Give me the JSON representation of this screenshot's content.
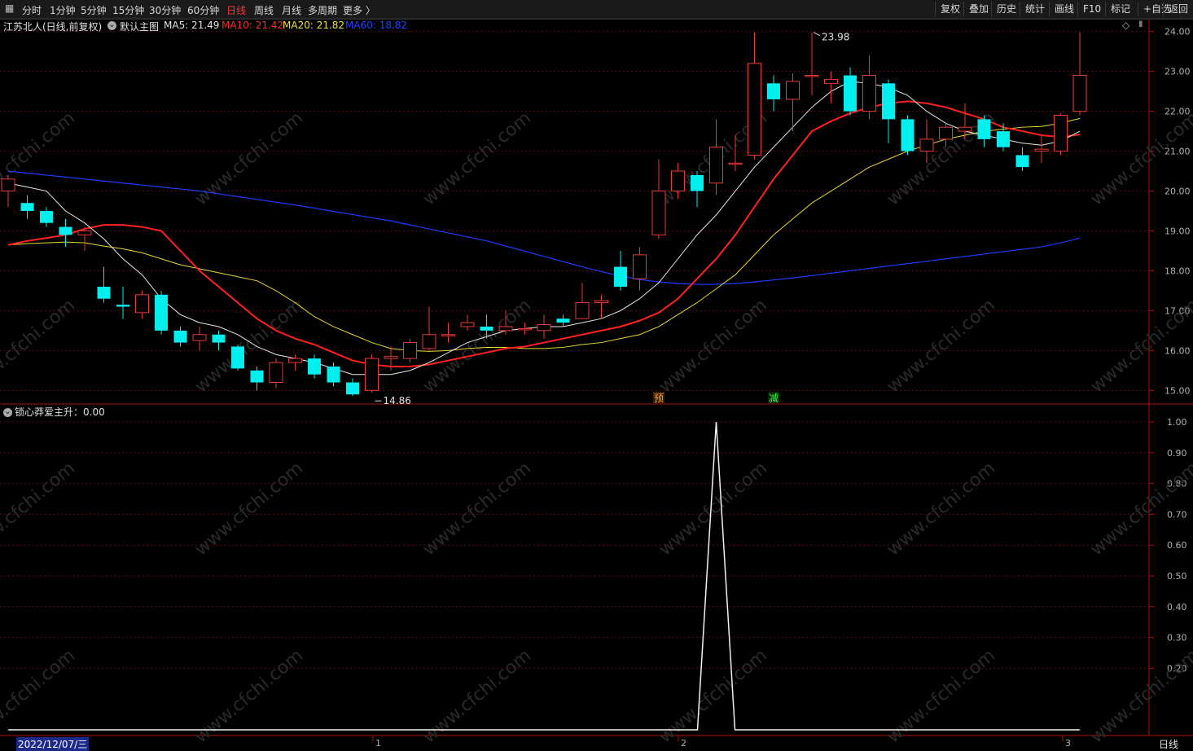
{
  "toolbar": {
    "left_icon": "grid-icon",
    "periods": [
      "分时",
      "1分钟",
      "5分钟",
      "15分钟",
      "30分钟",
      "60分钟",
      "日线",
      "周线",
      "月线",
      "多周期",
      "更多 〉"
    ],
    "active_period": "日线",
    "right": [
      "复权",
      "叠加",
      "历史",
      "统计",
      "画线",
      "F10",
      "标记",
      "+自选",
      "返回"
    ]
  },
  "main_panel": {
    "stock_title": "江苏北人(日线,前复权)",
    "template": "默认主图",
    "ma": [
      {
        "label": "MA5: 21.49",
        "color": "#e0e0e0"
      },
      {
        "label": "MA10: 21.42",
        "color": "#ff2a2a"
      },
      {
        "label": "MA20: 21.82",
        "color": "#f0e030"
      },
      {
        "label": "MA60: 18.82",
        "color": "#2040ff"
      }
    ],
    "high_label": "23.98",
    "low_label": "14.86",
    "signal_yu": "预",
    "signal_jian": "减",
    "y_ticks": [
      "24.00",
      "23.00",
      "22.00",
      "21.00",
      "20.00",
      "19.00",
      "18.00",
      "17.00",
      "16.00",
      "15.00"
    ]
  },
  "sub_panel": {
    "indicator": "锁心莽爱主升：0.00",
    "y_ticks": [
      "1.00",
      "0.90",
      "0.80",
      "0.70",
      "0.60",
      "0.50",
      "0.40",
      "0.30",
      "0.20"
    ]
  },
  "x_axis": {
    "cursor_date": "2022/12/07/三",
    "months": [
      "1",
      "2",
      "3"
    ],
    "period_button": "日线"
  },
  "watermark": "www.cfchi.com",
  "chart_data": {
    "type": "candlestick",
    "ylim": [
      14.6,
      24.4
    ],
    "candles": [
      {
        "o": 20.0,
        "c": 20.3,
        "h": 20.4,
        "l": 19.6
      },
      {
        "o": 19.7,
        "c": 19.5,
        "h": 19.9,
        "l": 19.3
      },
      {
        "o": 19.5,
        "c": 19.2,
        "h": 19.6,
        "l": 19.1
      },
      {
        "o": 19.1,
        "c": 18.9,
        "h": 19.3,
        "l": 18.6
      },
      {
        "o": 18.9,
        "c": 19.0,
        "h": 19.1,
        "l": 18.5
      },
      {
        "o": 17.6,
        "c": 17.3,
        "h": 18.1,
        "l": 17.2
      },
      {
        "o": 17.15,
        "c": 17.1,
        "h": 17.6,
        "l": 16.8
      },
      {
        "o": 16.95,
        "c": 17.4,
        "h": 17.5,
        "l": 16.8
      },
      {
        "o": 17.4,
        "c": 16.5,
        "h": 17.5,
        "l": 16.4
      },
      {
        "o": 16.5,
        "c": 16.2,
        "h": 16.6,
        "l": 16.1
      },
      {
        "o": 16.25,
        "c": 16.4,
        "h": 16.6,
        "l": 16.0
      },
      {
        "o": 16.4,
        "c": 16.2,
        "h": 16.5,
        "l": 16.0
      },
      {
        "o": 16.1,
        "c": 15.55,
        "h": 16.15,
        "l": 15.5
      },
      {
        "o": 15.5,
        "c": 15.2,
        "h": 15.6,
        "l": 15.0
      },
      {
        "o": 15.2,
        "c": 15.7,
        "h": 15.8,
        "l": 15.05
      },
      {
        "o": 15.7,
        "c": 15.8,
        "h": 15.9,
        "l": 15.5
      },
      {
        "o": 15.8,
        "c": 15.4,
        "h": 15.9,
        "l": 15.3
      },
      {
        "o": 15.6,
        "c": 15.2,
        "h": 15.7,
        "l": 15.1
      },
      {
        "o": 15.2,
        "c": 14.9,
        "h": 15.3,
        "l": 14.86
      },
      {
        "o": 15.0,
        "c": 15.8,
        "h": 15.9,
        "l": 14.95
      },
      {
        "o": 15.8,
        "c": 15.85,
        "h": 16.1,
        "l": 15.5
      },
      {
        "o": 15.8,
        "c": 16.2,
        "h": 16.3,
        "l": 15.7
      },
      {
        "o": 16.05,
        "c": 16.4,
        "h": 17.1,
        "l": 16.0
      },
      {
        "o": 16.4,
        "c": 16.4,
        "h": 16.7,
        "l": 16.2
      },
      {
        "o": 16.6,
        "c": 16.7,
        "h": 16.9,
        "l": 16.5
      },
      {
        "o": 16.6,
        "c": 16.5,
        "h": 16.9,
        "l": 16.3
      },
      {
        "o": 16.5,
        "c": 16.6,
        "h": 17.0,
        "l": 16.4
      },
      {
        "o": 16.55,
        "c": 16.55,
        "h": 16.7,
        "l": 16.4
      },
      {
        "o": 16.5,
        "c": 16.65,
        "h": 16.9,
        "l": 16.3
      },
      {
        "o": 16.8,
        "c": 16.7,
        "h": 16.9,
        "l": 16.6
      },
      {
        "o": 16.8,
        "c": 17.2,
        "h": 17.7,
        "l": 16.8
      },
      {
        "o": 17.2,
        "c": 17.25,
        "h": 17.4,
        "l": 16.8
      },
      {
        "o": 18.1,
        "c": 17.6,
        "h": 18.5,
        "l": 17.5
      },
      {
        "o": 17.8,
        "c": 18.4,
        "h": 18.6,
        "l": 17.5
      },
      {
        "o": 18.9,
        "c": 20.0,
        "h": 20.8,
        "l": 18.8
      },
      {
        "o": 20.0,
        "c": 20.5,
        "h": 20.7,
        "l": 19.8
      },
      {
        "o": 20.4,
        "c": 20.0,
        "h": 20.5,
        "l": 19.6
      },
      {
        "o": 20.2,
        "c": 21.1,
        "h": 21.8,
        "l": 19.9
      },
      {
        "o": 20.7,
        "c": 20.7,
        "h": 21.4,
        "l": 20.5
      },
      {
        "o": 20.9,
        "c": 23.2,
        "h": 23.98,
        "l": 20.8
      },
      {
        "o": 22.7,
        "c": 22.3,
        "h": 22.9,
        "l": 22.0
      },
      {
        "o": 22.3,
        "c": 22.75,
        "h": 22.95,
        "l": 21.5
      },
      {
        "o": 22.9,
        "c": 22.9,
        "h": 23.98,
        "l": 22.4
      },
      {
        "o": 22.7,
        "c": 22.8,
        "h": 23.0,
        "l": 22.2
      },
      {
        "o": 22.9,
        "c": 22.0,
        "h": 23.1,
        "l": 21.9
      },
      {
        "o": 22.0,
        "c": 22.9,
        "h": 23.4,
        "l": 21.8
      },
      {
        "o": 22.7,
        "c": 21.8,
        "h": 22.8,
        "l": 21.2
      },
      {
        "o": 21.8,
        "c": 21.0,
        "h": 21.9,
        "l": 20.9
      },
      {
        "o": 21.0,
        "c": 21.3,
        "h": 21.8,
        "l": 20.7
      },
      {
        "o": 21.3,
        "c": 21.6,
        "h": 21.7,
        "l": 21.1
      },
      {
        "o": 21.5,
        "c": 21.6,
        "h": 22.2,
        "l": 21.3
      },
      {
        "o": 21.8,
        "c": 21.3,
        "h": 21.9,
        "l": 21.1
      },
      {
        "o": 21.5,
        "c": 21.1,
        "h": 21.7,
        "l": 21.0
      },
      {
        "o": 20.9,
        "c": 20.6,
        "h": 21.1,
        "l": 20.5
      },
      {
        "o": 21.0,
        "c": 21.05,
        "h": 21.4,
        "l": 20.7
      },
      {
        "o": 21.0,
        "c": 21.9,
        "h": 21.95,
        "l": 20.9
      },
      {
        "o": 22.0,
        "c": 22.9,
        "h": 23.98,
        "l": 21.9
      }
    ],
    "ma5": [
      20.2,
      20.1,
      20.0,
      19.5,
      19.2,
      18.8,
      18.3,
      17.9,
      17.3,
      16.9,
      16.7,
      16.6,
      16.4,
      16.1,
      15.9,
      15.8,
      15.7,
      15.55,
      15.4,
      15.4,
      15.4,
      15.5,
      15.7,
      15.95,
      16.2,
      16.35,
      16.5,
      16.55,
      16.6,
      16.6,
      16.7,
      16.8,
      17.0,
      17.3,
      17.7,
      18.3,
      18.9,
      19.4,
      20.0,
      20.6,
      21.1,
      21.6,
      22.1,
      22.5,
      22.75,
      22.7,
      22.6,
      22.4,
      22.0,
      21.7,
      21.5,
      21.4,
      21.3,
      21.2,
      21.15,
      21.25,
      21.5
    ],
    "ma10": [
      18.65,
      18.75,
      18.82,
      18.9,
      19.05,
      19.15,
      19.15,
      19.1,
      19.0,
      18.5,
      18.0,
      17.6,
      17.2,
      16.8,
      16.5,
      16.3,
      16.15,
      15.95,
      15.75,
      15.65,
      15.6,
      15.6,
      15.65,
      15.75,
      15.85,
      15.95,
      16.05,
      16.1,
      16.2,
      16.3,
      16.4,
      16.5,
      16.6,
      16.75,
      16.95,
      17.3,
      17.8,
      18.3,
      18.9,
      19.6,
      20.3,
      20.9,
      21.5,
      21.75,
      21.95,
      22.1,
      22.2,
      22.25,
      22.2,
      22.1,
      21.95,
      21.8,
      21.6,
      21.5,
      21.4,
      21.35,
      21.42
    ],
    "ma20": [
      18.65,
      18.68,
      18.7,
      18.72,
      18.7,
      18.62,
      18.55,
      18.45,
      18.3,
      18.15,
      18.05,
      17.95,
      17.85,
      17.75,
      17.5,
      17.2,
      16.85,
      16.6,
      16.4,
      16.2,
      16.05,
      16.0,
      15.98,
      16.0,
      16.05,
      16.08,
      16.08,
      16.05,
      16.05,
      16.08,
      16.15,
      16.2,
      16.3,
      16.4,
      16.6,
      16.9,
      17.2,
      17.55,
      17.9,
      18.4,
      18.9,
      19.3,
      19.7,
      20.0,
      20.3,
      20.6,
      20.8,
      21.0,
      21.15,
      21.3,
      21.4,
      21.5,
      21.55,
      21.6,
      21.62,
      21.7,
      21.82
    ],
    "ma60": [
      20.5,
      20.45,
      20.4,
      20.35,
      20.3,
      20.25,
      20.2,
      20.15,
      20.1,
      20.05,
      20.0,
      19.93,
      19.86,
      19.79,
      19.72,
      19.65,
      19.57,
      19.49,
      19.41,
      19.33,
      19.25,
      19.15,
      19.05,
      18.95,
      18.85,
      18.75,
      18.62,
      18.49,
      18.36,
      18.23,
      18.1,
      17.98,
      17.87,
      17.78,
      17.72,
      17.68,
      17.66,
      17.66,
      17.68,
      17.72,
      17.77,
      17.82,
      17.88,
      17.94,
      18.0,
      18.06,
      18.12,
      18.18,
      18.24,
      18.3,
      18.36,
      18.42,
      18.48,
      18.54,
      18.6,
      18.7,
      18.82
    ],
    "sub_values_note": "indicator line is 0 except a spike of 1 at bar 37",
    "spike_bar": 37,
    "sub_ylim": [
      0.0,
      1.05
    ]
  }
}
